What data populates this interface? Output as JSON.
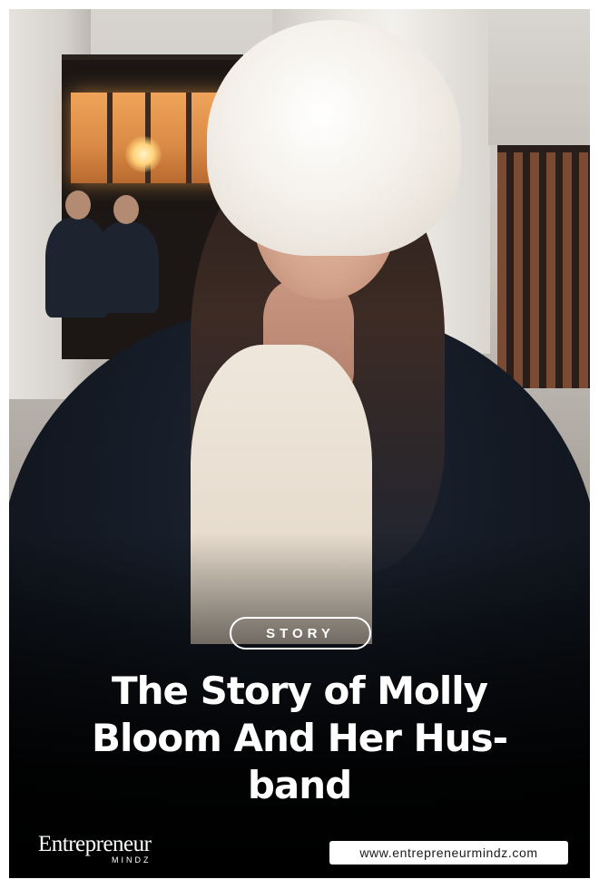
{
  "category_tag": "STORY",
  "headline": "The Story of Molly Bloom And Her Hus-band",
  "brand": {
    "name": "Entrepreneur",
    "subname": "MINDZ"
  },
  "website_url": "www.entrepreneurmindz.com",
  "photo": {
    "icon": "photo-of-woman-in-white-fur-hat-and-dark-fur-coat"
  },
  "colors": {
    "text": "#ffffff",
    "url_background": "#ffffff",
    "url_text": "#1a1a1a"
  }
}
